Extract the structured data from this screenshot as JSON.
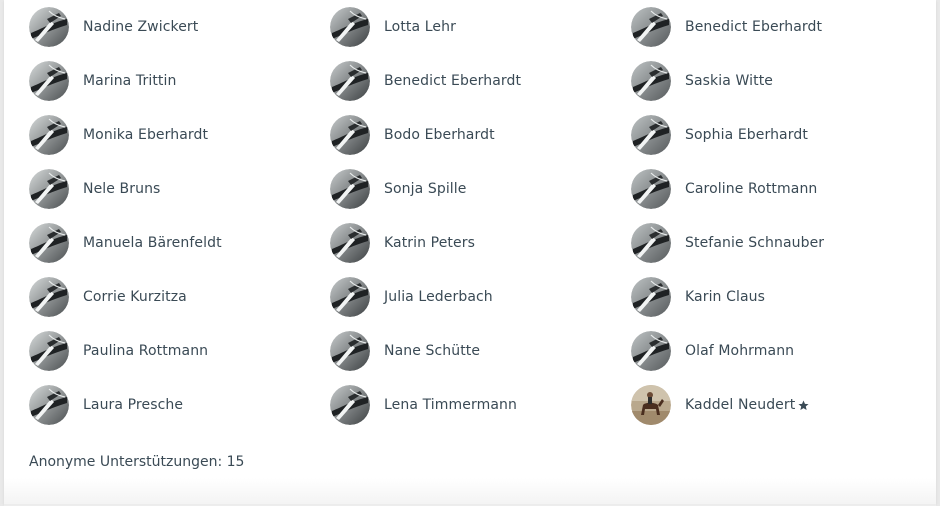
{
  "supporters": [
    {
      "name": "Nadine Zwickert",
      "avatar": "pen-icon"
    },
    {
      "name": "Lotta Lehr",
      "avatar": "pen-icon"
    },
    {
      "name": "Benedict Eberhardt",
      "avatar": "pen-icon"
    },
    {
      "name": "Marina Trittin",
      "avatar": "pen-icon"
    },
    {
      "name": "Benedict Eberhardt",
      "avatar": "pen-icon"
    },
    {
      "name": "Saskia Witte",
      "avatar": "pen-icon"
    },
    {
      "name": "Monika Eberhardt",
      "avatar": "pen-icon"
    },
    {
      "name": "Bodo Eberhardt",
      "avatar": "pen-icon"
    },
    {
      "name": "Sophia Eberhardt",
      "avatar": "pen-icon"
    },
    {
      "name": "Nele Bruns",
      "avatar": "pen-icon"
    },
    {
      "name": "Sonja Spille",
      "avatar": "pen-icon"
    },
    {
      "name": "Caroline Rottmann",
      "avatar": "pen-icon"
    },
    {
      "name": "Manuela Bärenfeldt",
      "avatar": "pen-icon"
    },
    {
      "name": "Katrin Peters",
      "avatar": "pen-icon"
    },
    {
      "name": "Stefanie Schnauber",
      "avatar": "pen-icon"
    },
    {
      "name": "Corrie Kurzitza",
      "avatar": "pen-icon"
    },
    {
      "name": "Julia Lederbach",
      "avatar": "pen-icon"
    },
    {
      "name": "Karin Claus",
      "avatar": "pen-icon"
    },
    {
      "name": "Paulina Rottmann",
      "avatar": "pen-icon"
    },
    {
      "name": "Nane Schütte",
      "avatar": "pen-icon"
    },
    {
      "name": "Olaf Mohrmann",
      "avatar": "pen-icon"
    },
    {
      "name": "Laura Presche",
      "avatar": "pen-icon"
    },
    {
      "name": "Lena Timmermann",
      "avatar": "pen-icon"
    },
    {
      "name": "Kaddel Neudert",
      "avatar": "photo-horse-rider",
      "starred": true,
      "badge_icon": "star-icon"
    }
  ],
  "footer": {
    "anonymous_text": "Anonyme Unterstützungen: 15"
  },
  "colors": {
    "text": "#3a4a55",
    "background": "#ffffff"
  }
}
